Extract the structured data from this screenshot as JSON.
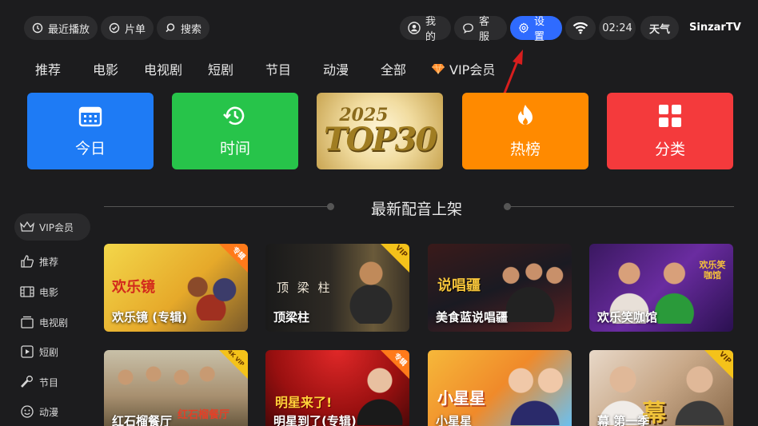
{
  "topbar": {
    "recent": "最近播放",
    "playlist": "片单",
    "search": "搜索",
    "mine": "我的",
    "service": "客服",
    "settings": "设置",
    "time": "02:24",
    "weather": "天气",
    "brand": "SinzarTV"
  },
  "nav": [
    "推荐",
    "电影",
    "电视剧",
    "短剧",
    "节目",
    "动漫",
    "全部",
    "VIP会员"
  ],
  "tiles": {
    "today": "今日",
    "time": "时间",
    "top_year": "2025",
    "top_text": "TOP30",
    "hot": "热榜",
    "category": "分类"
  },
  "section_title": "最新配音上架",
  "sidebar": [
    "VIP会员",
    "推荐",
    "电影",
    "电视剧",
    "短剧",
    "节目",
    "动漫"
  ],
  "cards": [
    {
      "title": "欢乐镜 (专辑)",
      "badge": "专辑",
      "art": "欢乐镜"
    },
    {
      "title": "顶梁柱",
      "badge": "VIP",
      "art": "顶 梁 柱"
    },
    {
      "title": "美食蓝说唱疆",
      "badge": "",
      "art": "说唱疆"
    },
    {
      "title": "欢乐笑咖馆",
      "badge": "",
      "art": "欢乐笑咖馆"
    },
    {
      "title": "红石榴餐厅",
      "badge": "4K VIP",
      "art": "红石榴餐厅"
    },
    {
      "title": "明星到了(专辑)",
      "badge": "专辑",
      "art": "明星来了!"
    },
    {
      "title": "小星星",
      "badge": "",
      "art": "小星星"
    },
    {
      "title": "幕 第一季",
      "badge": "VIP",
      "art": "幕"
    }
  ],
  "colors": {
    "background": "#1c1c1e",
    "accent": "#2f6bff",
    "annotation_arrow": "#d81e1e",
    "vip": "#f4c21a"
  }
}
